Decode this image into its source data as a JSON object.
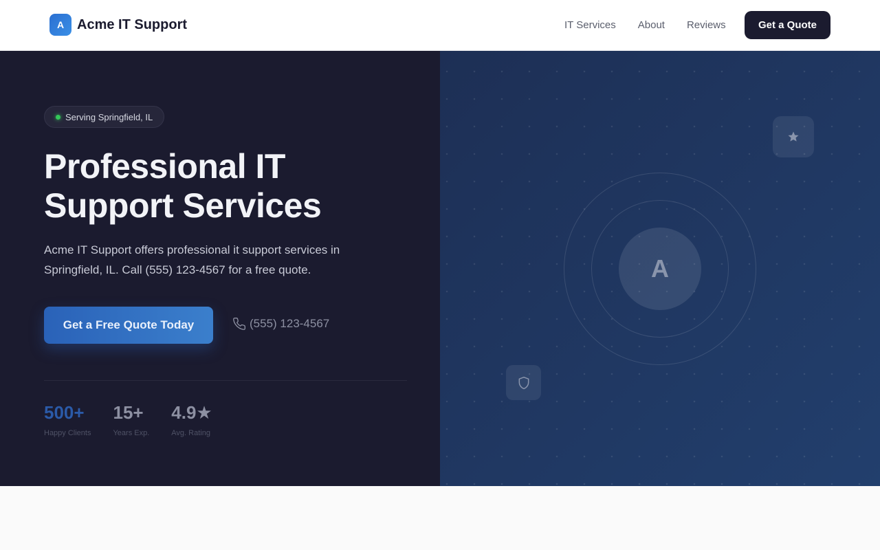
{
  "brand": {
    "logo_letter": "A",
    "name": "Acme IT Support"
  },
  "nav": {
    "links": [
      "IT Services",
      "About",
      "Reviews"
    ],
    "cta": "Get a Quote"
  },
  "hero": {
    "badge": "Serving Springfield, IL",
    "headline_line1": "Professional IT",
    "headline_line2": "Support Services",
    "lede": "Acme IT Support offers professional it support services in Springfield, IL. Call (555) 123-4567 for a free quote.",
    "cta": "Get a Free Quote Today",
    "phone": "(555) 123-4567",
    "stats": [
      {
        "value": "500+",
        "label": "Happy Clients"
      },
      {
        "value": "15+",
        "label": "Years Exp."
      },
      {
        "value": "4.9★",
        "label": "Avg. Rating"
      }
    ]
  },
  "visual": {
    "core_letter": "A",
    "icons": [
      "star-icon",
      "shield-icon"
    ]
  },
  "colors": {
    "nav_bg": "#ffffff",
    "hero_left_bg": "#1b1b2f",
    "hero_right_bg": "#1d2f55",
    "accent": "#2b6fd1",
    "status_dot": "#34c759"
  }
}
